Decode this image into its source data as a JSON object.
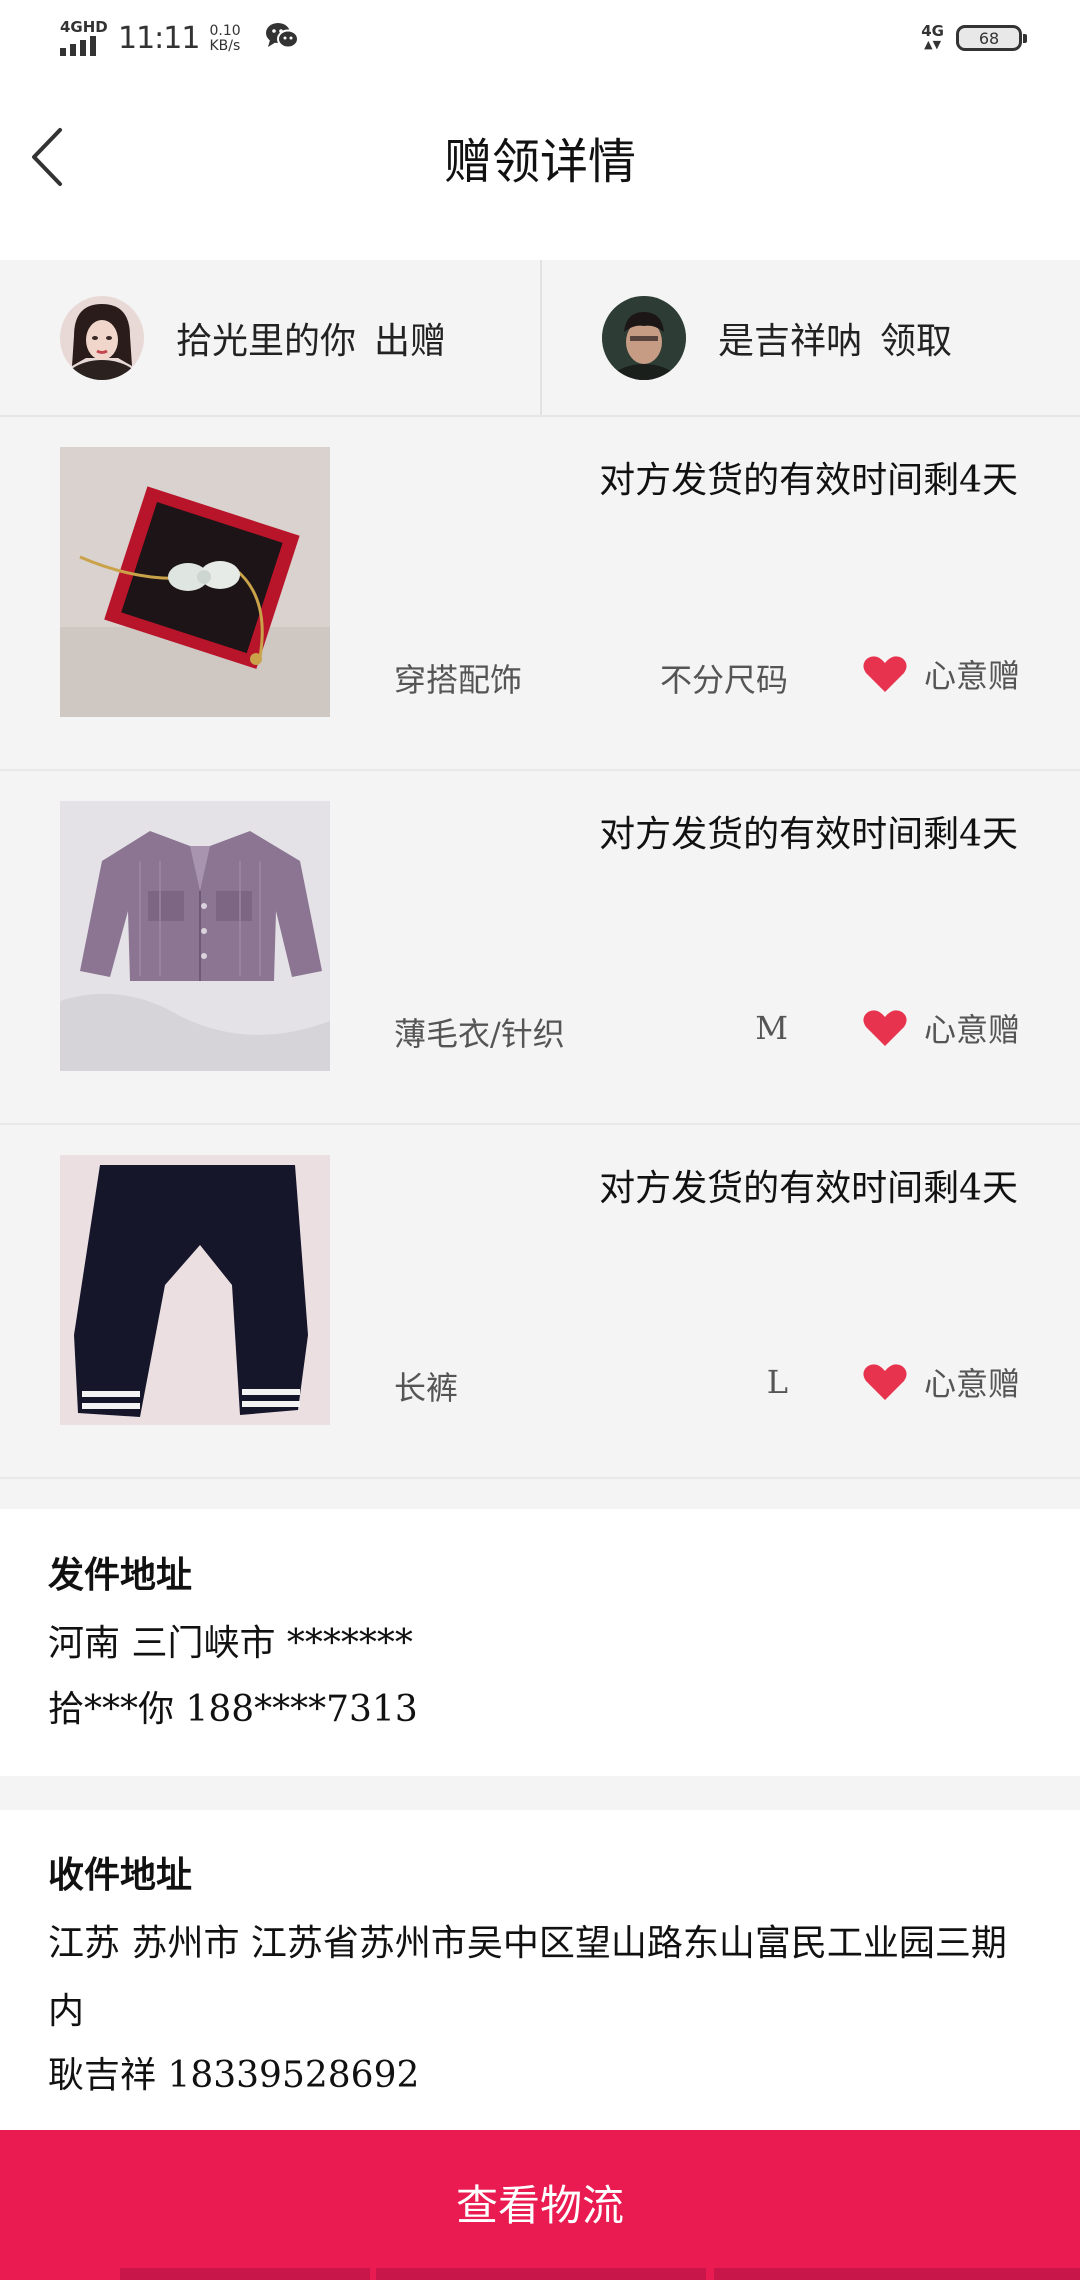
{
  "status_bar": {
    "network_label": "4GHD",
    "time": "11:11",
    "speed_value": "0.10",
    "speed_unit": "KB/s",
    "right_network_label": "4G",
    "battery_level": "68"
  },
  "header": {
    "title": "赠领详情",
    "back_icon": "chevron-left-icon"
  },
  "parties": {
    "giver": {
      "name": "拾光里的你",
      "action": "出赠",
      "avatar_icon": "avatar-female"
    },
    "receiver": {
      "name": "是吉祥呐",
      "action": "领取",
      "avatar_icon": "avatar-male"
    }
  },
  "items": [
    {
      "deadline": "对方发货的有效时间剩4天",
      "category": "穿搭配饰",
      "size": "不分尺码",
      "tag": "心意赠",
      "photo_icon": "bracelet-in-red-box"
    },
    {
      "deadline": "对方发货的有效时间剩4天",
      "category": "薄毛衣/针织",
      "size": "M",
      "tag": "心意赠",
      "photo_icon": "purple-knit-cardigan"
    },
    {
      "deadline": "对方发货的有效时间剩4天",
      "category": "长裤",
      "size": "L",
      "tag": "心意赠",
      "photo_icon": "black-jogger-pants"
    }
  ],
  "sender_address": {
    "title": "发件地址",
    "region": "河南  三门峡市  *******",
    "contact": "拾***你  188****7313"
  },
  "receiver_address": {
    "title": "收件地址",
    "address": "江苏  苏州市  江苏省苏州市吴中区望山路东山富民工业园三期内",
    "contact": "耿吉祥  18339528692"
  },
  "actions": {
    "view_logistics": "查看物流"
  },
  "colors": {
    "accent": "#e91b51",
    "heart": "#e8334f",
    "panel_bg": "#f4f4f4"
  }
}
